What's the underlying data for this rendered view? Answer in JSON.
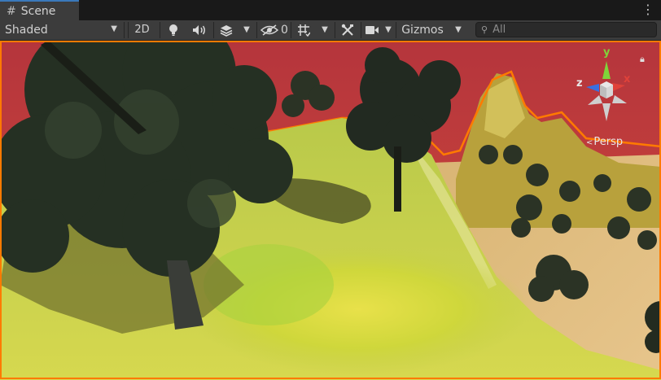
{
  "tab": {
    "icon": "hash-icon",
    "title": "Scene"
  },
  "toolbar": {
    "shading_mode": "Shaded",
    "mode_2d": "2D",
    "hidden_count": "0",
    "gizmos_label": "Gizmos",
    "search_placeholder": "All"
  },
  "gizmo": {
    "y": "y",
    "x": "x",
    "z": "z",
    "projection": "Persp"
  },
  "colors": {
    "accent": "#3a79bb",
    "toolbar": "#3c3c3c",
    "sky": "#b83a34",
    "grass": "#c8d64a",
    "selection_outline": "#ff7a00"
  }
}
